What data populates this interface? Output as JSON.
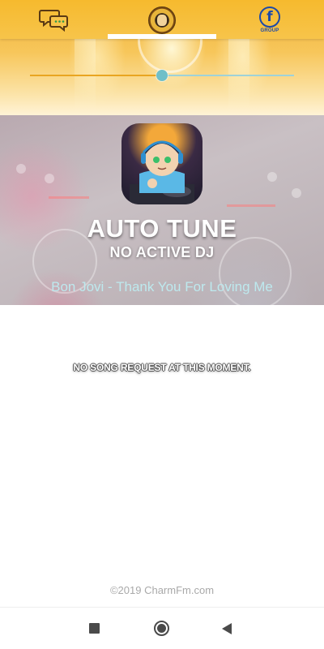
{
  "app": {
    "name": "CharmFm"
  },
  "topbar": {
    "chat_icon": "chat-bubbles-icon",
    "logo_icon": "station-logo",
    "facebook_icon": "facebook-icon",
    "facebook_label": "GROUP"
  },
  "player": {
    "volume_level": 0.5,
    "colors": {
      "track": "#9fd2d8",
      "fill": "#e9a521",
      "thumb": "#6fbfc8"
    }
  },
  "dj": {
    "name": "AUTO TUNE",
    "status": "NO ACTIVE DJ",
    "now_playing": "Bon Jovi - Thank You For Loving Me"
  },
  "requests": {
    "empty_message": "NO SONG REQUEST AT THIS MOMENT."
  },
  "footer": {
    "copyright": "©2019 CharmFm.com"
  },
  "navbar": {
    "recents_icon": "square-icon",
    "home_icon": "home-circle-icon",
    "back_icon": "back-triangle-icon"
  },
  "colors": {
    "accent": "#f6ba2e",
    "now_playing": "#bde9ee",
    "facebook": "#1e4aa8"
  }
}
